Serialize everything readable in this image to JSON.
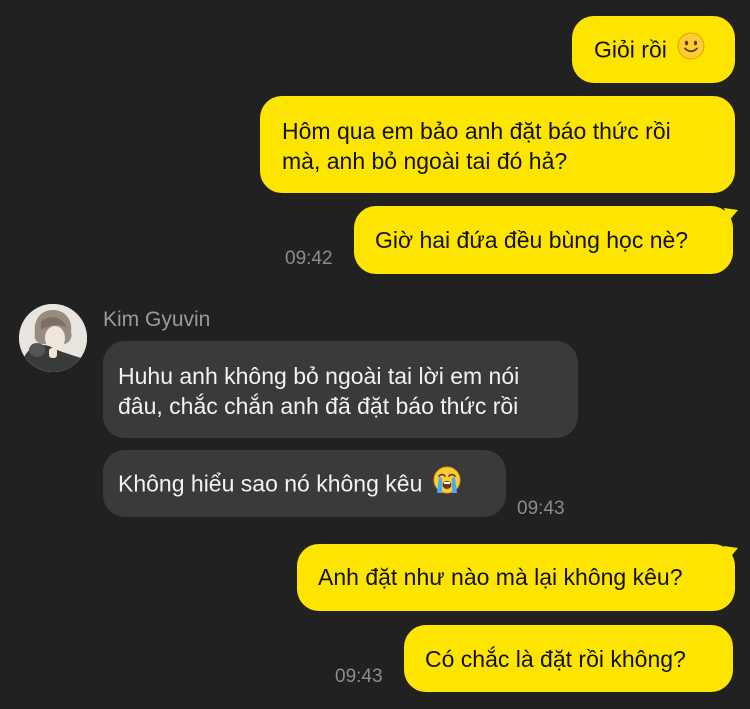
{
  "colors": {
    "background": "#212121",
    "outgoing_bubble": "#fee500",
    "incoming_bubble": "#3a3a3a",
    "timestamp": "#8c8c8c"
  },
  "messages": {
    "m1": {
      "text": "Giỏi rồi",
      "emoji": "slightly-smiling-face-icon"
    },
    "m2": {
      "line1": "Hôm qua em bảo anh đặt báo thức rồi",
      "line2": "mà, anh bỏ ngoài tai đó hả?"
    },
    "m3": {
      "text": "Giờ hai đứa đều bùng học nè?",
      "time": "09:42"
    },
    "sender_name": "Kim Gyuvin",
    "m4": {
      "line1": "Huhu anh không bỏ ngoài tai lời em nói",
      "line2": "đâu, chắc chắn anh đã đặt báo thức rồi"
    },
    "m5": {
      "text": "Không hiểu sao nó không kêu",
      "emoji": "loudly-crying-face-icon",
      "time": "09:43"
    },
    "m6": {
      "text": "Anh đặt như nào mà lại không kêu?"
    },
    "m7": {
      "text": "Có chắc là đặt rồi không?",
      "time": "09:43"
    }
  }
}
